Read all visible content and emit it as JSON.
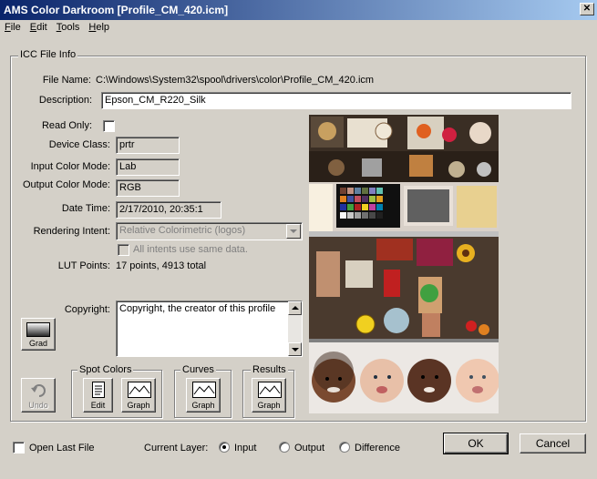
{
  "window": {
    "title": "AMS Color Darkroom [Profile_CM_420.icm]",
    "close_glyph": "✕"
  },
  "menu": [
    {
      "label": "File",
      "u": "F",
      "rest": "ile"
    },
    {
      "label": "Edit",
      "u": "E",
      "rest": "dit"
    },
    {
      "label": "Tools",
      "u": "T",
      "rest": "ools"
    },
    {
      "label": "Help",
      "u": "H",
      "rest": "elp"
    }
  ],
  "icc": {
    "group_label": "ICC File Info",
    "file_name_label": "File Name:",
    "file_name_value": "C:\\Windows\\System32\\spool\\drivers\\color\\Profile_CM_420.icm",
    "description_label": "Description:",
    "description_value": "Epson_CM_R220_Silk",
    "read_only_label": "Read Only:",
    "read_only_checked": false,
    "device_class_label": "Device Class:",
    "device_class_value": "prtr",
    "input_mode_label": "Input Color Mode:",
    "input_mode_value": "Lab",
    "output_mode_label": "Output Color Mode:",
    "output_mode_value": "RGB",
    "date_time_label": "Date Time:",
    "date_time_value": "2/17/2010, 20:35:1",
    "rendering_intent_label": "Rendering Intent:",
    "rendering_intent_value": "Relative Colorimetric (logos)",
    "all_intents_label": "All intents use same data.",
    "lut_points_label": "LUT Points:",
    "lut_points_value": "17 points, 4913 total",
    "copyright_label": "Copyright:",
    "copyright_value": "Copyright, the creator of this profile"
  },
  "buttons": {
    "grad": "Grad",
    "undo": "Undo",
    "spot_colors_label": "Spot Colors",
    "spot_edit": "Edit",
    "spot_graph": "Graph",
    "curves_label": "Curves",
    "curves_graph": "Graph",
    "results_label": "Results",
    "results_graph": "Graph",
    "ok": "OK",
    "cancel": "Cancel"
  },
  "bottom": {
    "open_last_file_label": "Open Last File",
    "open_last_file_checked": false,
    "current_layer_label": "Current Layer:",
    "layers": [
      {
        "label": "Input",
        "checked": true
      },
      {
        "label": "Output",
        "checked": false
      },
      {
        "label": "Difference",
        "checked": false
      }
    ]
  },
  "icons": {
    "grad": "gradient-icon",
    "undo": "undo-arrow-icon",
    "edit": "document-edit-icon",
    "graph": "graph-curve-icon"
  },
  "colors": {
    "title_start": "#0a246a",
    "title_end": "#a6caf0",
    "face": "#d4d0c8"
  }
}
